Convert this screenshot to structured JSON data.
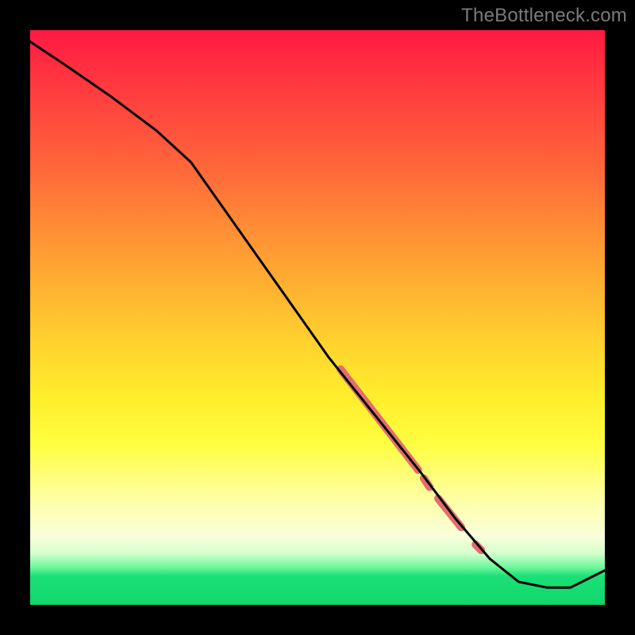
{
  "watermark": "TheBottleneck.com",
  "colors": {
    "background": "#000000",
    "curve": "#000000",
    "highlight": "#e36d6d",
    "watermark": "#7b7b7b"
  },
  "chart_data": {
    "type": "line",
    "title": "",
    "xlabel": "",
    "ylabel": "",
    "xlim": [
      0,
      100
    ],
    "ylim": [
      0,
      100
    ],
    "curve": {
      "x": [
        0,
        6,
        14,
        22,
        28,
        40,
        52,
        60,
        68,
        74,
        80,
        85,
        90,
        94,
        100
      ],
      "y": [
        98,
        94,
        88.5,
        82.5,
        77,
        60,
        43,
        33,
        23,
        15,
        8,
        4,
        3,
        3,
        6
      ]
    },
    "highlight_segments": [
      {
        "x": [
          54,
          67.5
        ],
        "y": [
          41,
          23.5
        ],
        "width": 10
      },
      {
        "x": [
          68.5,
          69.5
        ],
        "y": [
          22,
          20.5
        ],
        "width": 10
      },
      {
        "x": [
          71,
          75
        ],
        "y": [
          18.5,
          13.5
        ],
        "width": 10
      },
      {
        "x": [
          77.5,
          78.5
        ],
        "y": [
          10.5,
          9.5
        ],
        "width": 10
      }
    ]
  }
}
